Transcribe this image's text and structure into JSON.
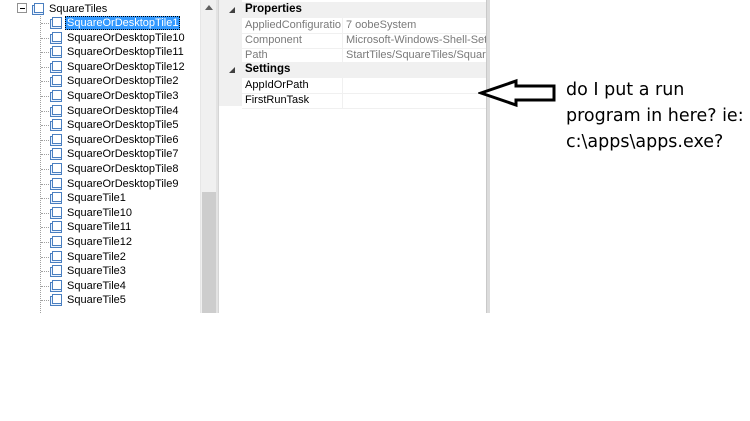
{
  "tree": {
    "parent": "SquareTiles",
    "items": [
      {
        "label": "SquareOrDesktopTile1",
        "selected": true
      },
      {
        "label": "SquareOrDesktopTile10"
      },
      {
        "label": "SquareOrDesktopTile11"
      },
      {
        "label": "SquareOrDesktopTile12"
      },
      {
        "label": "SquareOrDesktopTile2"
      },
      {
        "label": "SquareOrDesktopTile3"
      },
      {
        "label": "SquareOrDesktopTile4"
      },
      {
        "label": "SquareOrDesktopTile5"
      },
      {
        "label": "SquareOrDesktopTile6"
      },
      {
        "label": "SquareOrDesktopTile7"
      },
      {
        "label": "SquareOrDesktopTile8"
      },
      {
        "label": "SquareOrDesktopTile9"
      },
      {
        "label": "SquareTile1"
      },
      {
        "label": "SquareTile10"
      },
      {
        "label": "SquareTile11"
      },
      {
        "label": "SquareTile12"
      },
      {
        "label": "SquareTile2"
      },
      {
        "label": "SquareTile3"
      },
      {
        "label": "SquareTile4"
      },
      {
        "label": "SquareTile5"
      }
    ]
  },
  "properties": {
    "category_properties": "Properties",
    "category_settings": "Settings",
    "readonly": [
      {
        "name": "AppliedConfigurationP",
        "value": "7 oobeSystem"
      },
      {
        "name": "Component",
        "value": "Microsoft-Windows-Shell-Setup"
      },
      {
        "name": "Path",
        "value": "StartTiles/SquareTiles/SquareOr"
      }
    ],
    "settings": [
      {
        "name": "AppIdOrPath",
        "value": ""
      },
      {
        "name": "FirstRunTask",
        "value": ""
      }
    ]
  },
  "annotation": {
    "lines": [
      "do I put a run",
      "program in here? ie:",
      "c:\\apps\\apps.exe?"
    ]
  },
  "colors": {
    "selection": "#3399ff",
    "grid_gray": "#f0f0f0",
    "readonly_text": "#7a7a7a"
  },
  "icons": {
    "tree_item": "square-tile-icon",
    "folder": "folder-icon",
    "collapse": "collapse-minus-icon",
    "arrow": "left-arrow-icon"
  }
}
